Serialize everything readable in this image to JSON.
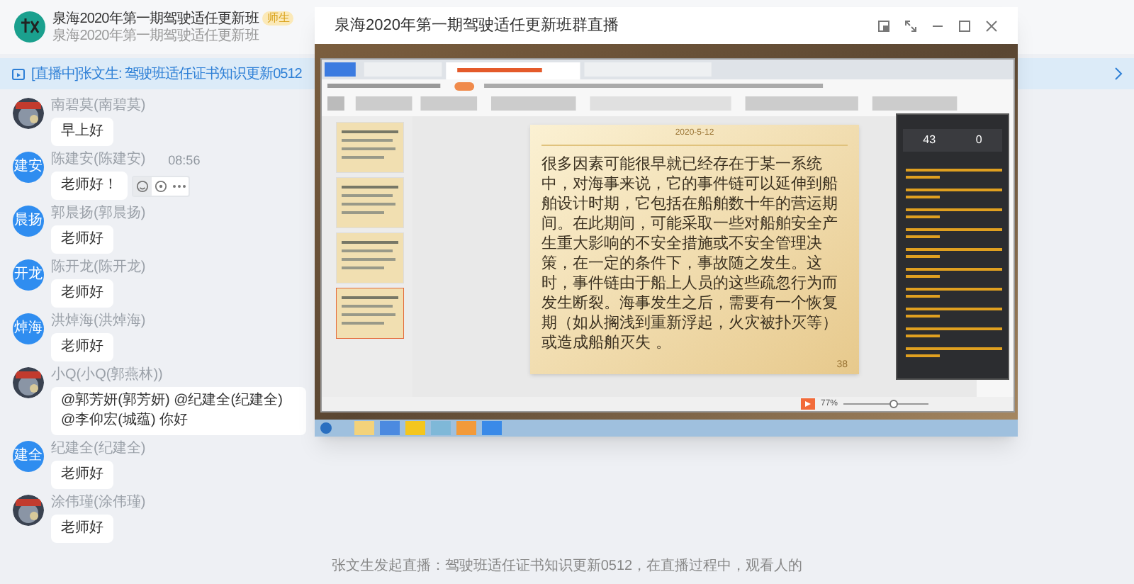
{
  "group": {
    "title": "泉海2020年第一期驾驶适任更新班",
    "tag": "师生",
    "subtitle": "泉海2020年第一期驾驶适任更新班"
  },
  "live_banner": {
    "text": "[直播中]张文生: 驾驶班适任证书知识更新0512"
  },
  "messages": [
    {
      "sender": "南碧莫(南碧莫)",
      "text": "早上好",
      "hovered": false
    },
    {
      "sender": "陈建安(陈建安)",
      "time": "08:56",
      "text": "老师好！",
      "avatar": {
        "kind": "text",
        "label": "建安"
      },
      "hovered": true
    },
    {
      "sender": "郭晨扬(郭晨扬)",
      "text": "老师好",
      "avatar": {
        "kind": "text",
        "label": "晨扬"
      },
      "hovered": false
    },
    {
      "sender": "陈开龙(陈开龙)",
      "text": "老师好",
      "avatar": {
        "kind": "text",
        "label": "开龙"
      },
      "hovered": false
    },
    {
      "sender": "洪焯海(洪焯海)",
      "text": "老师好",
      "avatar": {
        "kind": "text",
        "label": "焯海"
      },
      "hovered": false
    },
    {
      "sender": "小Q(小Q(郭燕林))",
      "text": "@郭芳妍(郭芳妍) @纪建全(纪建全) @李仰宏(城蕴) 你好",
      "hovered": false
    },
    {
      "sender": "纪建全(纪建全)",
      "text": "老师好",
      "avatar": {
        "kind": "text",
        "label": "建全"
      },
      "hovered": false
    },
    {
      "sender": "涂伟瑾(涂伟瑾)",
      "text": "老师好",
      "hovered": false
    }
  ],
  "system_notice": "张文生发起直播：驾驶班适任证书知识更新0512，在直播过程中，观看人的",
  "live_window": {
    "title": "泉海2020年第一期驾驶适任更新班群直播",
    "slide": {
      "date": "2020-5-12",
      "text": "很多因素可能很早就已经存在于某一系统中，对海事来说，它的事件链可以延伸到船舶设计时期，它包括在船舶数十年的营运期间。在此期间，可能采取一些对船舶安全产生重大影响的不安全措施或不安全管理决策，在一定的条件下，事故随之发生。这时，事件链由于船上人员的这些疏忽行为而发生断裂。海事发生之后，需要有一个恢复期（如从搁浅到重新浮起，火灾被扑灭等）或造成船舶灭失 。",
      "page": "38"
    },
    "stats": [
      {
        "value": "43"
      },
      {
        "value": "0"
      }
    ],
    "zoom": "77%",
    "zoom_slider": {
      "level": 0.6
    }
  }
}
